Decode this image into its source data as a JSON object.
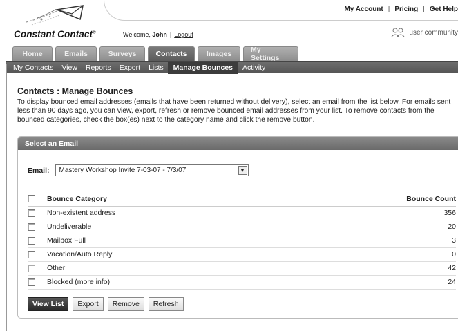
{
  "top_links": [
    "My Account",
    "Pricing",
    "Get Help"
  ],
  "brand": {
    "name": "Constant Contact",
    "mark": "®"
  },
  "welcome": {
    "prefix": "Welcome,",
    "user": "John",
    "logout": "Logout"
  },
  "community": "user community",
  "tabs": [
    {
      "label": "Home",
      "active": false
    },
    {
      "label": "Emails",
      "active": false
    },
    {
      "label": "Surveys",
      "active": false
    },
    {
      "label": "Contacts",
      "active": true
    },
    {
      "label": "Images",
      "active": false
    },
    {
      "label": "My Settings",
      "active": false
    }
  ],
  "subnav": [
    {
      "label": "My Contacts",
      "active": false
    },
    {
      "label": "View",
      "active": false
    },
    {
      "label": "Reports",
      "active": false
    },
    {
      "label": "Export",
      "active": false
    },
    {
      "label": "Lists",
      "active": false
    },
    {
      "label": "Manage Bounces",
      "active": true
    },
    {
      "label": "Activity",
      "active": false
    }
  ],
  "page": {
    "title": "Contacts : Manage Bounces",
    "description": "To display bounced email addresses (emails that have been returned without delivery), select an email from the list below. For emails sent less than 90 days ago, you can view, export, refresh or remove bounced email addresses from your list. To remove contacts from the bounced categories, check the box(es) next to the category name and click the remove button."
  },
  "panel": {
    "header": "Select an Email",
    "email_label": "Email:",
    "email_selected": "Mastery Workshop Invite 7-03-07 - 7/3/07",
    "columns": {
      "category": "Bounce Category",
      "count": "Bounce Count"
    },
    "rows": [
      {
        "category": "Non-existent address",
        "count": "356"
      },
      {
        "category": "Undeliverable",
        "count": "20"
      },
      {
        "category": "Mailbox Full",
        "count": "3"
      },
      {
        "category": "Vacation/Auto Reply",
        "count": "0"
      },
      {
        "category": "Other",
        "count": "42"
      },
      {
        "category": "Blocked",
        "link": "more info",
        "count": "24"
      }
    ],
    "buttons": {
      "view_list": "View List",
      "export": "Export",
      "remove": "Remove",
      "refresh": "Refresh"
    }
  }
}
